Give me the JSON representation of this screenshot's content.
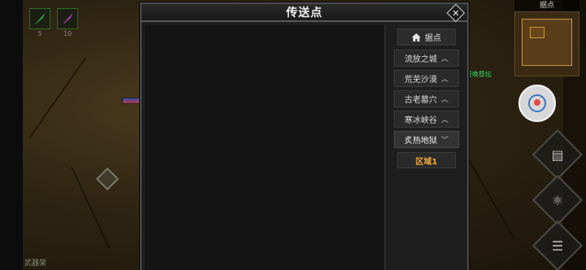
{
  "dialog": {
    "title": "传送点",
    "close_icon": "close-icon",
    "home_label": "据点",
    "regions": [
      {
        "label": "流放之城",
        "state": "collapsed"
      },
      {
        "label": "荒芜沙漠",
        "state": "collapsed"
      },
      {
        "label": "古老墓穴",
        "state": "collapsed"
      },
      {
        "label": "寒冰峡谷",
        "state": "collapsed"
      },
      {
        "label": "炙热地狱",
        "state": "expanded"
      }
    ],
    "zones": [
      {
        "label": "区域1",
        "color": "#f2a93b"
      }
    ]
  },
  "hud": {
    "slots": [
      {
        "icon": "green-feather-icon",
        "count": "5"
      },
      {
        "icon": "purple-feather-icon",
        "count": "10"
      }
    ],
    "minimap_title": "据点",
    "npc_label": "召唤祭坛",
    "weapon_rack_label": "武器架"
  },
  "colors": {
    "accent": "#f2a93b",
    "panel": "#1e1e1e",
    "npc_label": "#3fd06a"
  }
}
